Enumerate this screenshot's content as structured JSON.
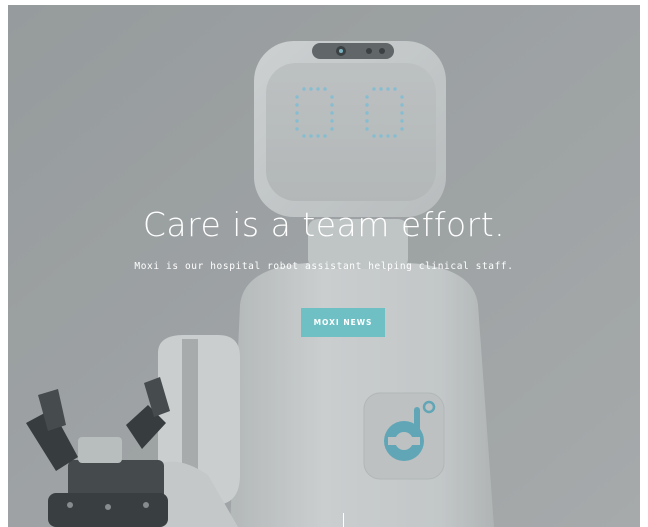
{
  "hero": {
    "headline": "Care is a team effort.",
    "subtext": "Moxi is our hospital robot assistant helping clinical staff.",
    "cta_label": "MOXI NEWS"
  },
  "colors": {
    "accent": "#6ec0c4",
    "background": "#a8abad",
    "robot_body": "#e3e5e6",
    "face_dots": "#8fd3ec"
  },
  "icons": [
    "robot-eye-left",
    "robot-eye-right",
    "robot-logo-icon",
    "robot-gripper"
  ]
}
